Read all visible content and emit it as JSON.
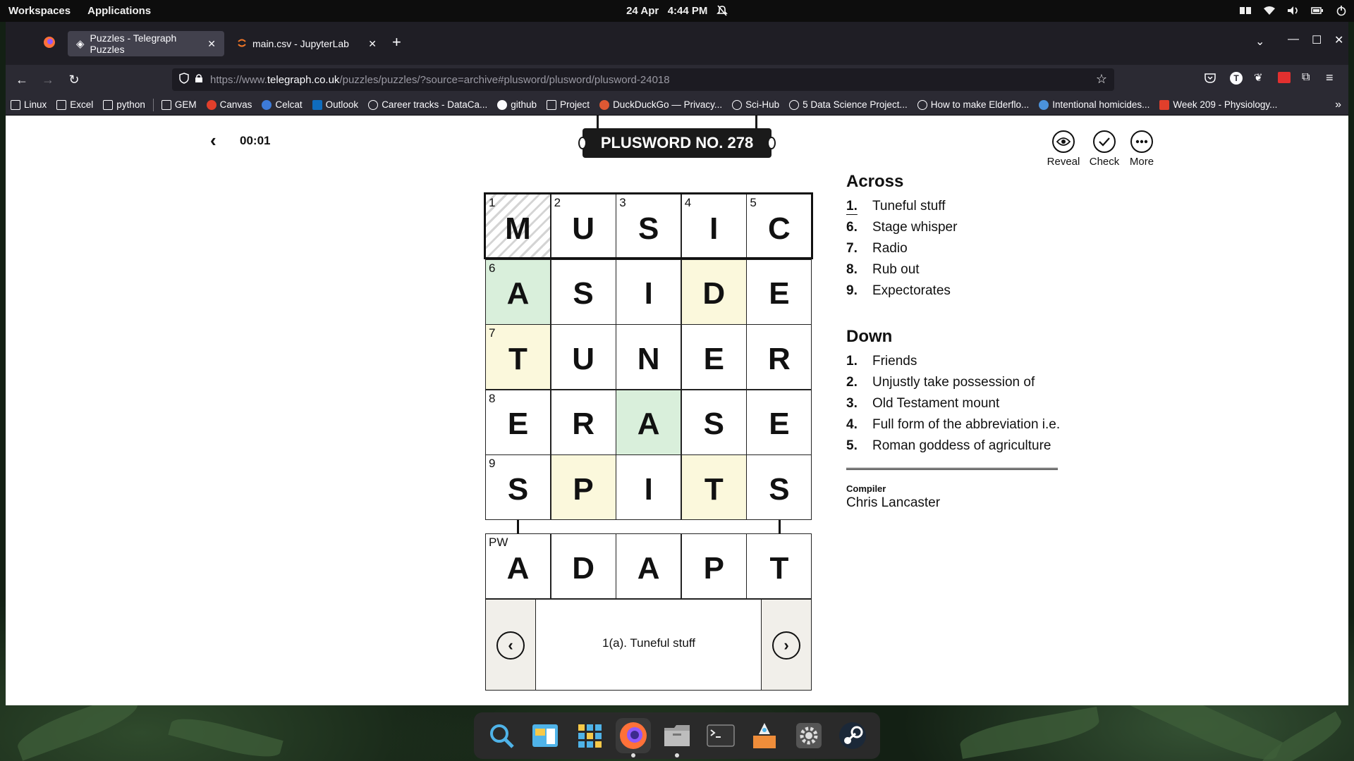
{
  "system_bar": {
    "workspaces": "Workspaces",
    "applications": "Applications",
    "date": "24 Apr",
    "time": "4:44 PM"
  },
  "browser": {
    "tabs": [
      {
        "label": "Puzzles - Telegraph Puzzles",
        "active": true
      },
      {
        "label": "main.csv - JupyterLab",
        "active": false
      }
    ],
    "url": {
      "prefix": "https://www.",
      "domain": "telegraph.co.uk",
      "path": "/puzzles/puzzles/?source=archive#plusword/plusword/plusword-24018"
    },
    "bookmarks": [
      "Linux",
      "Excel",
      "python",
      "GEM",
      "Canvas",
      "Celcat",
      "Outlook",
      "Career tracks - DataCa...",
      "github",
      "Project",
      "DuckDuckGo — Privacy...",
      "Sci-Hub",
      "5 Data Science Project...",
      "How to make Elderflo...",
      "Intentional homicides...",
      "Week 209 - Physiology..."
    ]
  },
  "puzzle": {
    "timer": "00:01",
    "title": "PLUSWORD NO. 278",
    "actions": {
      "reveal": "Reveal",
      "check": "Check",
      "more": "More"
    },
    "grid": [
      [
        "M",
        "U",
        "S",
        "I",
        "C"
      ],
      [
        "A",
        "S",
        "I",
        "D",
        "E"
      ],
      [
        "T",
        "U",
        "N",
        "E",
        "R"
      ],
      [
        "E",
        "R",
        "A",
        "S",
        "E"
      ],
      [
        "S",
        "P",
        "I",
        "T",
        "S"
      ]
    ],
    "numbers": [
      [
        "1",
        "2",
        "3",
        "4",
        "5"
      ],
      [
        "6",
        "",
        "",
        "",
        ""
      ],
      [
        "7",
        "",
        "",
        "",
        ""
      ],
      [
        "8",
        "",
        "",
        "",
        ""
      ],
      [
        "9",
        "",
        "",
        "",
        ""
      ]
    ],
    "cell_states": [
      [
        "selected",
        "plain",
        "plain",
        "plain",
        "plain"
      ],
      [
        "green",
        "plain",
        "plain",
        "yellow",
        "plain"
      ],
      [
        "yellow",
        "plain",
        "plain",
        "plain",
        "plain"
      ],
      [
        "plain",
        "plain",
        "green",
        "plain",
        "plain"
      ],
      [
        "plain",
        "yellow",
        "plain",
        "yellow",
        "plain"
      ]
    ],
    "plusword_label": "PW",
    "plusword": [
      "A",
      "D",
      "A",
      "P",
      "T"
    ],
    "current_clue": "1(a). Tuneful stuff",
    "colors": {
      "green": "#d9efdb",
      "yellow": "#fbf8dc",
      "nav_panel": "#f1efea",
      "title_bg": "#1a1a1a"
    }
  },
  "clues": {
    "across_heading": "Across",
    "across": [
      {
        "n": "1.",
        "text": "Tuneful stuff"
      },
      {
        "n": "6.",
        "text": "Stage whisper"
      },
      {
        "n": "7.",
        "text": "Radio"
      },
      {
        "n": "8.",
        "text": "Rub out"
      },
      {
        "n": "9.",
        "text": "Expectorates"
      }
    ],
    "down_heading": "Down",
    "down": [
      {
        "n": "1.",
        "text": "Friends"
      },
      {
        "n": "2.",
        "text": "Unjustly take possession of"
      },
      {
        "n": "3.",
        "text": "Old Testament mount"
      },
      {
        "n": "4.",
        "text": "Full form of the abbreviation i.e."
      },
      {
        "n": "5.",
        "text": "Roman goddess of agriculture"
      }
    ],
    "compiler_label": "Compiler",
    "compiler": "Chris Lancaster"
  }
}
